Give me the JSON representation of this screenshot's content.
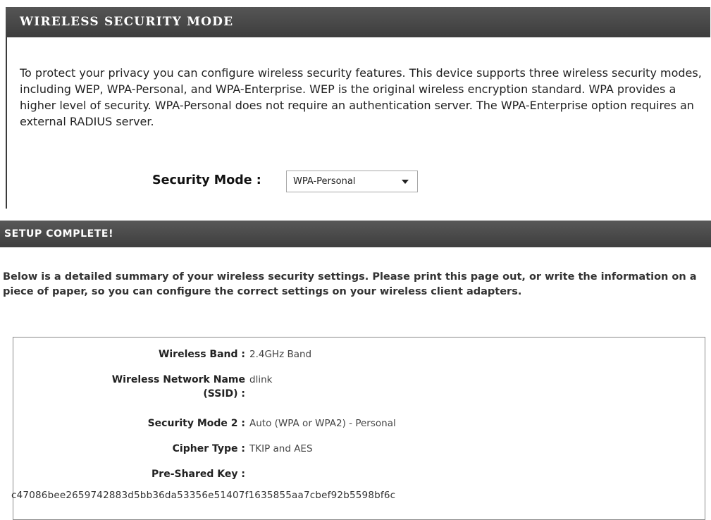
{
  "security_mode_panel": {
    "title": "WIRELESS SECURITY MODE",
    "description": "To protect your privacy you can configure wireless security features. This device supports three wireless security modes, including WEP, WPA-Personal, and WPA-Enterprise. WEP is the original wireless encryption standard. WPA provides a higher level of security. WPA-Personal does not require an authentication server. The WPA-Enterprise option requires an external RADIUS server.",
    "security_mode_label": "Security Mode :",
    "security_mode_value": "WPA-Personal"
  },
  "setup_complete_panel": {
    "title": "SETUP COMPLETE!",
    "intro": "Below is a detailed summary of your wireless security settings. Please print this page out, or write the information on a piece of paper, so you can configure the correct settings on your wireless client adapters.",
    "summary": {
      "wireless_band_label": "Wireless Band :",
      "wireless_band_value": "2.4GHz Band",
      "network_name_label_line1": "Wireless Network Name",
      "network_name_label_line2": "(SSID) :",
      "network_name_value": "dlink",
      "security_mode_label": "Security Mode 2 :",
      "security_mode_value": "Auto (WPA or WPA2) - Personal",
      "cipher_type_label": "Cipher Type :",
      "cipher_type_value": "TKIP and AES",
      "psk_label": "Pre-Shared Key :",
      "psk_value": "c47086bee2659742883d5bb36da53356e51407f1635855aa7cbef92b5598bf6c"
    }
  }
}
